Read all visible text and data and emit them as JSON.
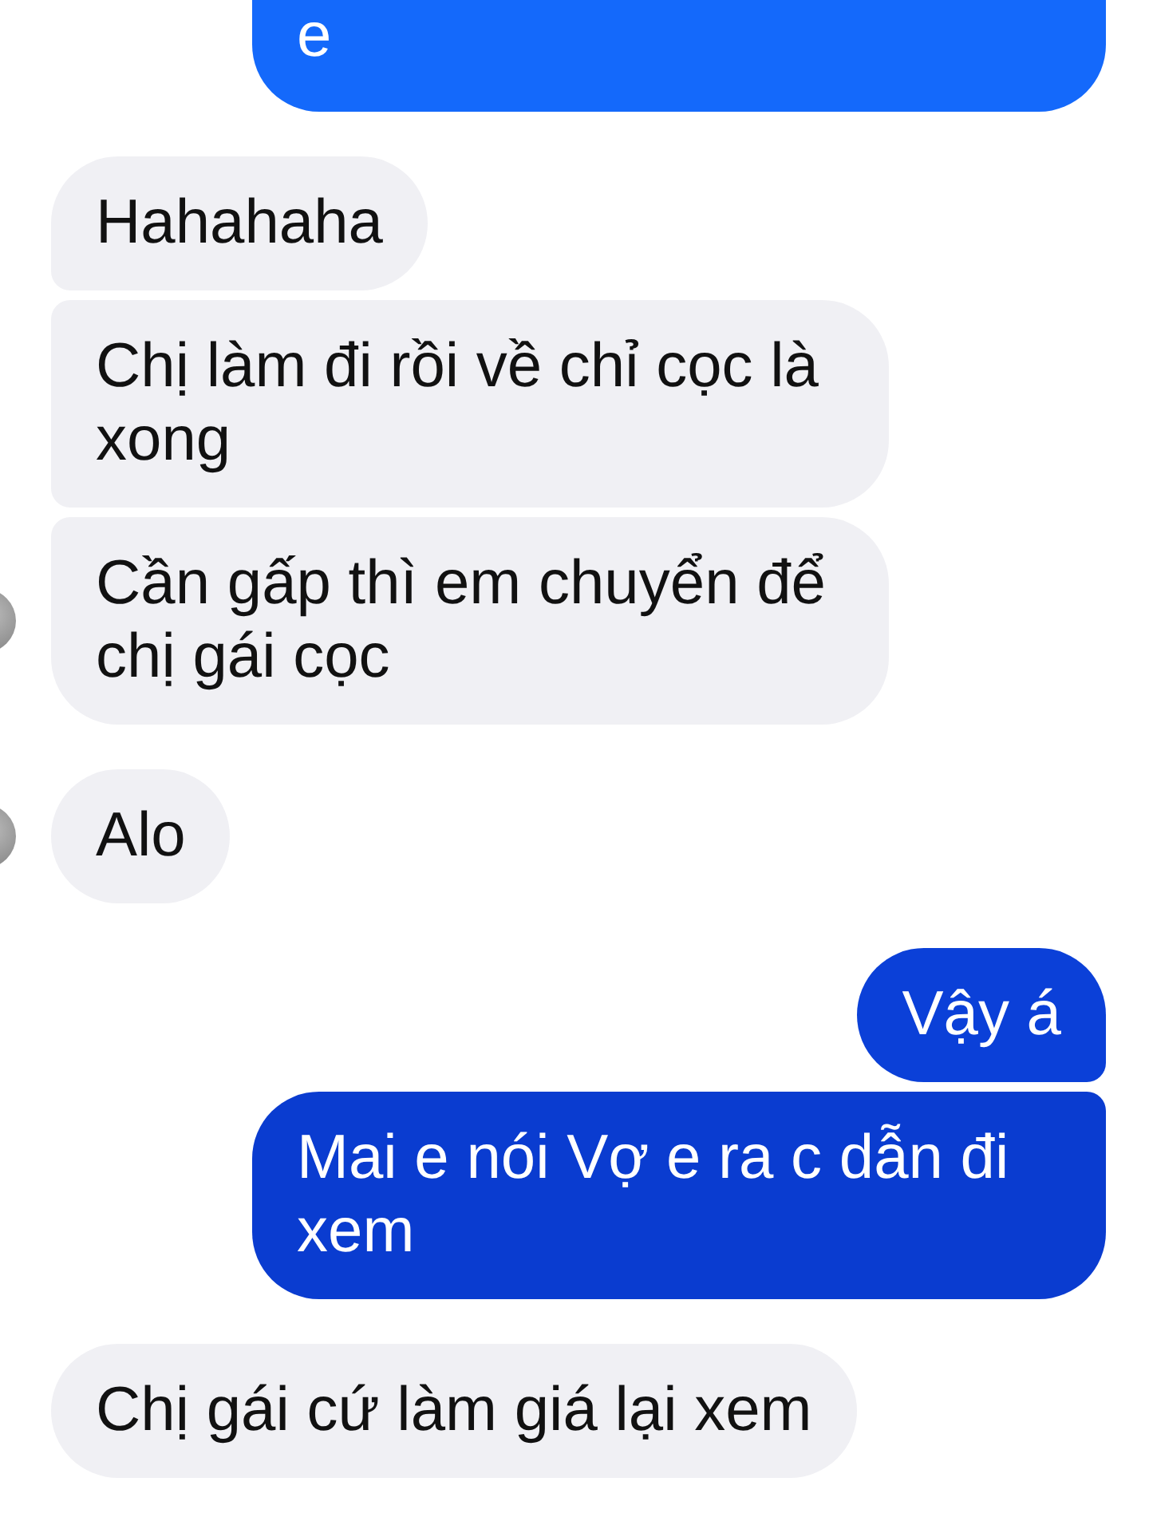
{
  "groups": [
    {
      "kind": "outgoing",
      "messages": [
        {
          "text": "e",
          "cut": true,
          "color": "#1469fb"
        }
      ]
    },
    {
      "kind": "incoming",
      "avatar": true,
      "messages": [
        {
          "text": "Hahahaha"
        },
        {
          "text": "Chị làm đi rồi về chỉ cọc là xong"
        },
        {
          "text": "Cần gấp thì em chuyển để chị gái cọc"
        }
      ]
    },
    {
      "kind": "incoming",
      "avatar": true,
      "messages": [
        {
          "text": "Alo"
        }
      ]
    },
    {
      "kind": "outgoing",
      "messages": [
        {
          "text": "Vậy á",
          "color": "#0b40d8"
        },
        {
          "text": "Mai e nói Vợ e ra c dẫn đi xem",
          "color": "#0a3cd0"
        }
      ]
    },
    {
      "kind": "incoming",
      "avatar": false,
      "messages": [
        {
          "text": "Chị gái cứ làm giá lại xem"
        }
      ]
    }
  ]
}
